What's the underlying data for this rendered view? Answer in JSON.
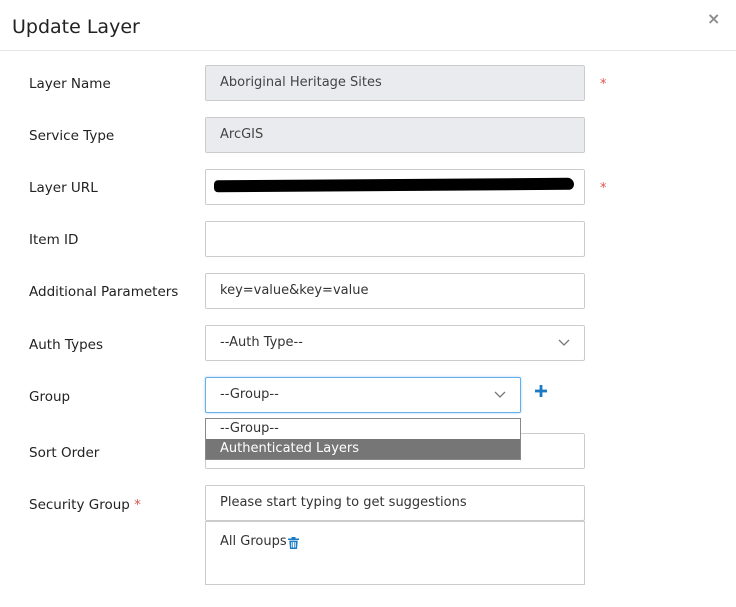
{
  "dialog": {
    "title": "Update Layer",
    "close_symbol": "×"
  },
  "form": {
    "layer_name": {
      "label": "Layer Name",
      "value": "Aboriginal Heritage Sites",
      "required_mark": "*"
    },
    "service_type": {
      "label": "Service Type",
      "value": "ArcGIS"
    },
    "layer_url": {
      "label": "Layer URL",
      "value": "",
      "redacted": true,
      "required_mark": "*"
    },
    "item_id": {
      "label": "Item ID",
      "value": ""
    },
    "additional_parameters": {
      "label": "Additional Parameters",
      "value": "key=value&key=value"
    },
    "auth_types": {
      "label": "Auth Types",
      "selected": "--Auth Type--"
    },
    "group": {
      "label": "Group",
      "selected": "--Group--",
      "options": [
        "--Group--",
        "Authenticated Layers"
      ],
      "highlighted_option": "Authenticated Layers"
    },
    "sort_order": {
      "label": "Sort Order",
      "value": ""
    },
    "security_group": {
      "label": "Security Group",
      "required_mark": "*",
      "placeholder": "Please start typing to get suggestions",
      "selected_groups": [
        "All Groups"
      ]
    }
  },
  "icons": {
    "close": "close-icon",
    "chevron": "chevron-down-icon",
    "add": "plus-icon",
    "delete": "trash-icon"
  },
  "colors": {
    "required": "#d9534f",
    "accent_blue": "#1a7bc4",
    "readonly_bg": "#e9ebee",
    "focus_border": "#66afe9",
    "highlight_option": "#767676"
  }
}
